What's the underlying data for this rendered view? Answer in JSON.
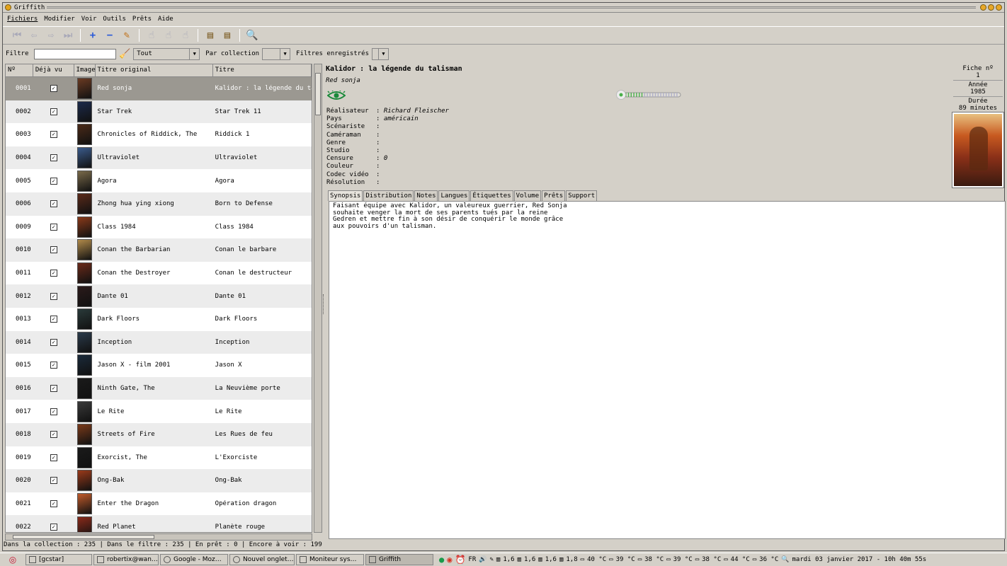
{
  "window": {
    "title": "Griffith"
  },
  "menu": [
    "Fichiers",
    "Modifier",
    "Voir",
    "Outils",
    "Prêts",
    "Aide"
  ],
  "toolbar": {
    "icons": [
      "first-icon",
      "prev-icon",
      "next-icon",
      "last-icon",
      "add-icon",
      "remove-icon",
      "edit-icon",
      "loan-icon",
      "return-icon",
      "history-icon",
      "import-icon",
      "export-icon",
      "search-icon"
    ]
  },
  "filter": {
    "label": "Filtre",
    "value": "",
    "scope": "Tout",
    "collection_label": "Par collection",
    "collection_value": "",
    "saved_label": "Filtres enregistrés"
  },
  "list": {
    "headers": {
      "num": "Nº",
      "seen": "Déjà vu",
      "image": "Image",
      "orig": "Titre original",
      "title": "Titre"
    },
    "rows": [
      {
        "num": "0001",
        "orig": "Red sonja",
        "title": "Kalidor : la légende du talisman",
        "seen": "✓",
        "color": "#6a3a22"
      },
      {
        "num": "0002",
        "orig": "Star Trek",
        "title": "Star Trek 11",
        "seen": "✓",
        "color": "#1c2a4a"
      },
      {
        "num": "0003",
        "orig": "Chronicles of Riddick, The",
        "title": "Riddick 1",
        "seen": "✓",
        "color": "#4a2a18"
      },
      {
        "num": "0004",
        "orig": "Ultraviolet",
        "title": "Ultraviolet",
        "seen": "✓",
        "color": "#3a5a8a"
      },
      {
        "num": "0005",
        "orig": "Agora",
        "title": "Agora",
        "seen": "✓",
        "color": "#7a6a4a"
      },
      {
        "num": "0006",
        "orig": "Zhong hua ying xiong",
        "title": "Born to Defense",
        "seen": "✓",
        "color": "#5a2a1a"
      },
      {
        "num": "0009",
        "orig": "Class 1984",
        "title": "Class 1984",
        "seen": "✓",
        "color": "#8a3a1a"
      },
      {
        "num": "0010",
        "orig": "Conan the Barbarian",
        "title": "Conan le barbare",
        "seen": "✓",
        "color": "#b08a4a"
      },
      {
        "num": "0011",
        "orig": "Conan the Destroyer",
        "title": "Conan le destructeur",
        "seen": "✓",
        "color": "#6a2a1a"
      },
      {
        "num": "0012",
        "orig": "Dante 01",
        "title": "Dante 01",
        "seen": "✓",
        "color": "#2a1a1a"
      },
      {
        "num": "0013",
        "orig": "Dark Floors",
        "title": "Dark Floors",
        "seen": "✓",
        "color": "#2a3a3a"
      },
      {
        "num": "0014",
        "orig": "Inception",
        "title": "Inception",
        "seen": "✓",
        "color": "#2a3a4a"
      },
      {
        "num": "0015",
        "orig": "Jason X - film 2001",
        "title": "Jason X",
        "seen": "✓",
        "color": "#1a2a3a"
      },
      {
        "num": "0016",
        "orig": "Ninth Gate, The",
        "title": "La Neuvième porte",
        "seen": "✓",
        "color": "#1a1a1a"
      },
      {
        "num": "0017",
        "orig": "Le Rite",
        "title": "Le Rite",
        "seen": "✓",
        "color": "#3a3a3a"
      },
      {
        "num": "0018",
        "orig": "Streets of Fire",
        "title": "Les Rues de feu",
        "seen": "✓",
        "color": "#7a3a1a"
      },
      {
        "num": "0019",
        "orig": "Exorcist, The",
        "title": "L'Exorciste",
        "seen": "✓",
        "color": "#1a1a1a"
      },
      {
        "num": "0020",
        "orig": "Ong-Bak",
        "title": "Ong-Bak",
        "seen": "✓",
        "color": "#9a3a1a"
      },
      {
        "num": "0021",
        "orig": "Enter the Dragon",
        "title": "Opération dragon",
        "seen": "✓",
        "color": "#c05a2a"
      },
      {
        "num": "0022",
        "orig": "Red Planet",
        "title": "Planète rouge",
        "seen": "✓",
        "color": "#8a2a1a"
      }
    ]
  },
  "detail": {
    "title": "Kalidor : la légende du talisman",
    "original_title": "Red sonja",
    "rating": 0.35,
    "fields": [
      {
        "label": "Réalisateur",
        "value": "Richard Fleischer"
      },
      {
        "label": "Pays",
        "value": "américain"
      },
      {
        "label": "Scénariste",
        "value": ""
      },
      {
        "label": "Caméraman",
        "value": ""
      },
      {
        "label": "Genre",
        "value": ""
      },
      {
        "label": "Studio",
        "value": ""
      },
      {
        "label": "Censure",
        "value": "0"
      },
      {
        "label": "Couleur",
        "value": ""
      },
      {
        "label": "Codec vidéo",
        "value": ""
      },
      {
        "label": "Résolution",
        "value": ""
      }
    ],
    "fiche_label": "Fiche nº",
    "fiche_value": "1",
    "year_label": "Année",
    "year_value": "1985",
    "duration_label": "Durée",
    "duration_value": "89  minutes",
    "tabs": [
      "Synopsis",
      "Distribution",
      "Notes",
      "Langues",
      "Étiquettes",
      "Volume",
      "Prêts",
      "Support"
    ],
    "synopsis": "Faisant équipe avec Kalidor, un valeureux guerrier, Red Sonja\nsouhaite venger la mort de ses parents tués par la reine\nGedren et mettre fin à son désir de conquérir le monde grâce\naux pouvoirs d'un talisman."
  },
  "status": "Dans la collection : 235 | Dans le filtre : 235 | En prêt : 0 | Encore à voir : 199",
  "taskbar": {
    "tasks": [
      "[gcstar]",
      "robertix@wan…",
      "Google - Moz…",
      "Nouvel onglet…",
      "Moniteur sys…",
      "Griffith"
    ],
    "tray": [
      "FR",
      "1,6",
      "1,6",
      "1,6",
      "1,8",
      "40 °C",
      "39 °C",
      "38 °C",
      "39 °C",
      "38 °C",
      "44 °C",
      "36 °C"
    ],
    "clock": "mardi 03 janvier 2017 - 10h 40m 55s"
  }
}
